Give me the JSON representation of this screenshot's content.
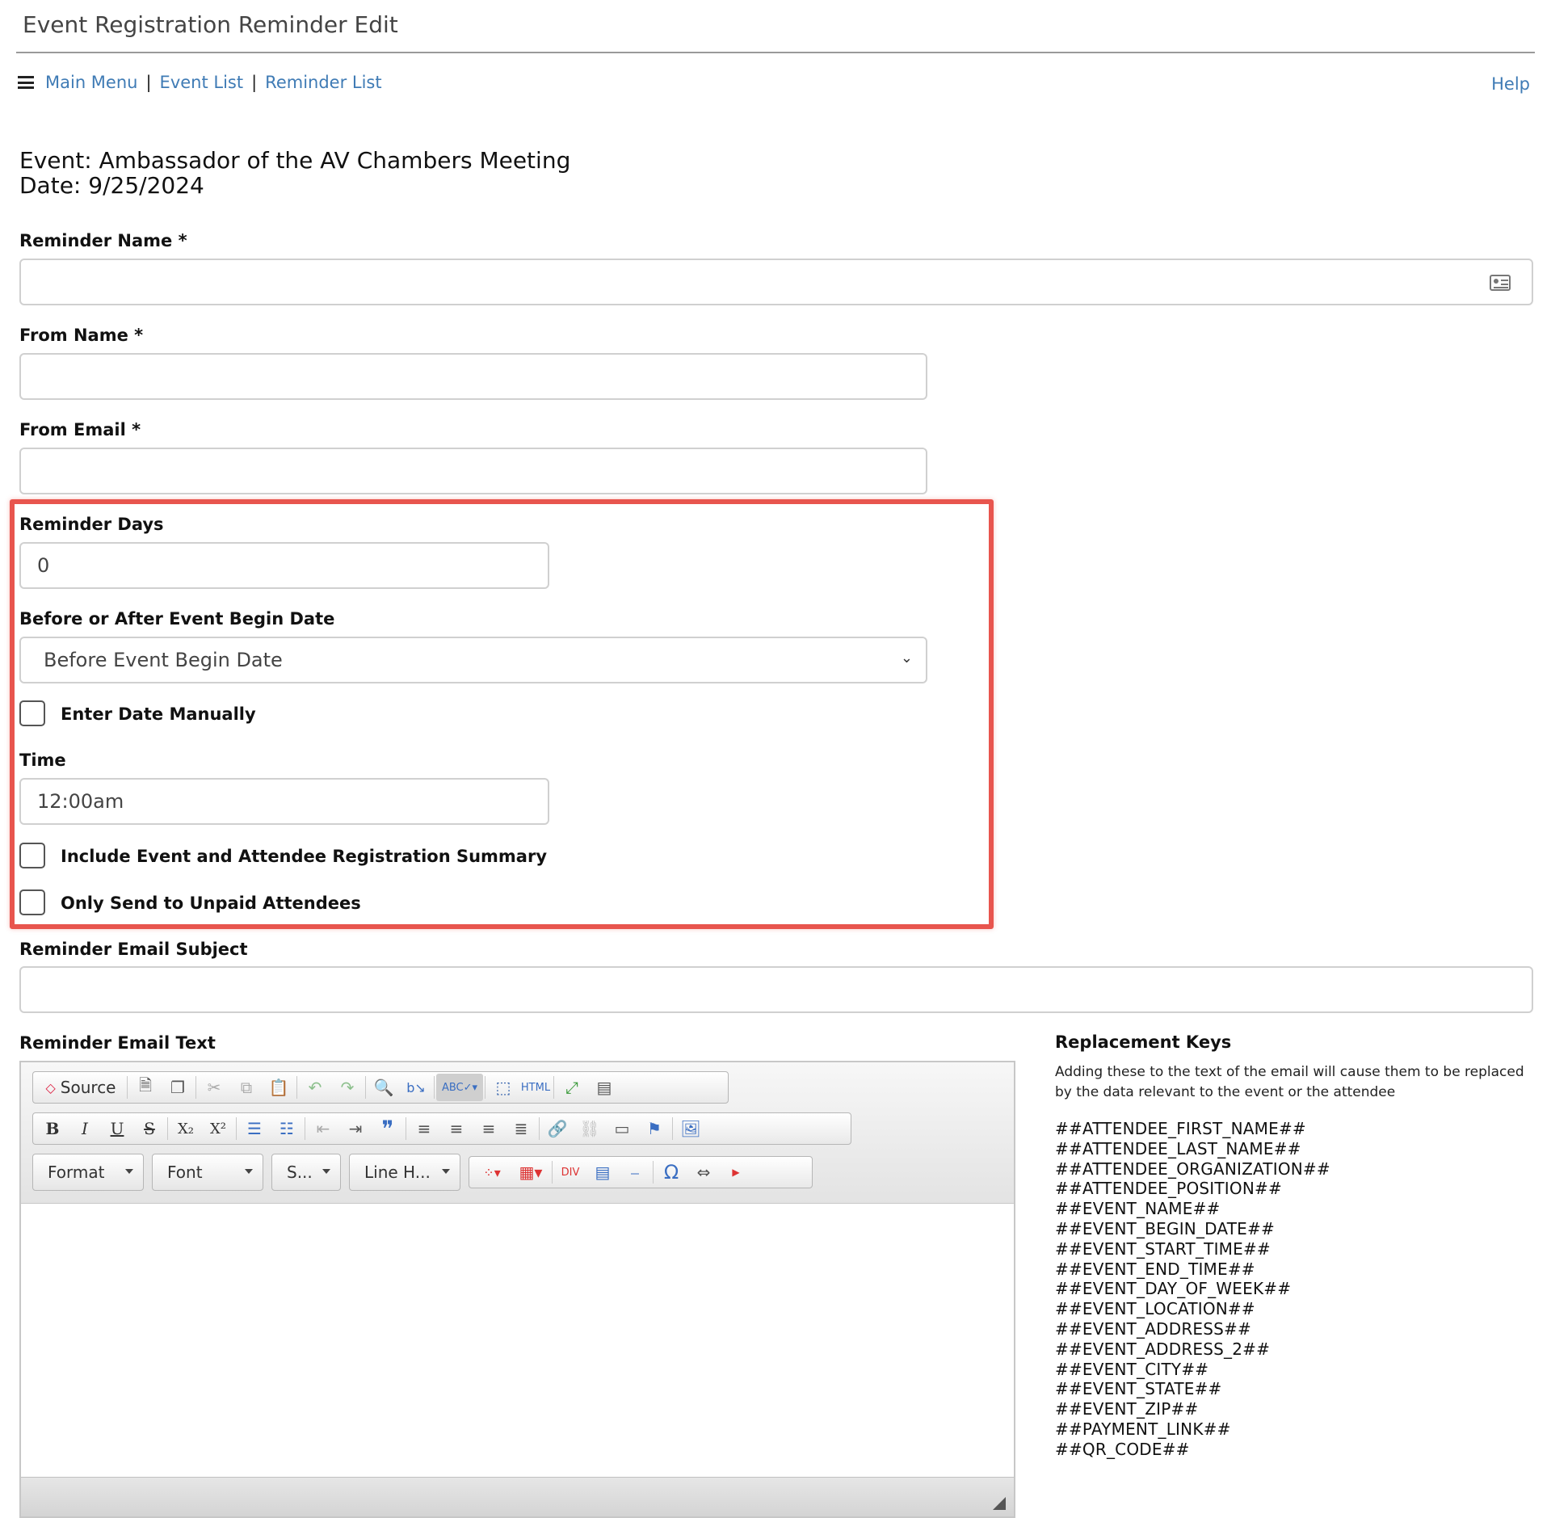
{
  "page": {
    "title": "Event Registration Reminder Edit"
  },
  "nav": {
    "main_menu": "Main Menu",
    "separator": "|",
    "event_list": "Event List",
    "reminder_list": "Reminder List",
    "help": "Help"
  },
  "event": {
    "line": "Event: Ambassador of the AV Chambers Meeting",
    "date_line": "Date: 9/25/2024"
  },
  "form": {
    "reminder_name": {
      "label": "Reminder Name *",
      "value": ""
    },
    "from_name": {
      "label": "From Name *",
      "value": ""
    },
    "from_email": {
      "label": "From Email *",
      "value": ""
    },
    "reminder_days": {
      "label": "Reminder Days",
      "value": "0"
    },
    "before_after": {
      "label": "Before or After Event Begin Date",
      "selected": "Before Event Begin Date"
    },
    "enter_date_manually": {
      "label": "Enter Date Manually",
      "checked": false
    },
    "time": {
      "label": "Time",
      "value": "12:00am"
    },
    "include_summary": {
      "label": "Include Event and Attendee Registration Summary",
      "checked": false
    },
    "only_unpaid": {
      "label": "Only Send to Unpaid Attendees",
      "checked": false
    },
    "email_subject": {
      "label": "Reminder Email Subject",
      "value": ""
    },
    "email_text": {
      "label": "Reminder Email Text"
    }
  },
  "editor": {
    "source_label": "Source",
    "combos": {
      "format": "Format",
      "font": "Font",
      "size": "S...",
      "line_height": "Line H..."
    },
    "buttons": {
      "bold": "B",
      "italic": "I",
      "underline": "U",
      "strike": "S",
      "subscript": "X₂",
      "superscript": "X²",
      "blockquote": "❞",
      "special_char": "Ω"
    }
  },
  "replacement_keys": {
    "title": "Replacement Keys",
    "description": "Adding these to the text of the email will cause them to be replaced by the data relevant to the event or the attendee",
    "keys": [
      "##ATTENDEE_FIRST_NAME##",
      "##ATTENDEE_LAST_NAME##",
      "##ATTENDEE_ORGANIZATION##",
      "##ATTENDEE_POSITION##",
      "##EVENT_NAME##",
      "##EVENT_BEGIN_DATE##",
      "##EVENT_START_TIME##",
      "##EVENT_END_TIME##",
      "##EVENT_DAY_OF_WEEK##",
      "##EVENT_LOCATION##",
      "##EVENT_ADDRESS##",
      "##EVENT_ADDRESS_2##",
      "##EVENT_CITY##",
      "##EVENT_STATE##",
      "##EVENT_ZIP##",
      "##PAYMENT_LINK##",
      "##QR_CODE##"
    ]
  },
  "colors": {
    "link": "#3f7bb5",
    "highlight": "#e8554e",
    "input_border": "#d0d0d0"
  }
}
